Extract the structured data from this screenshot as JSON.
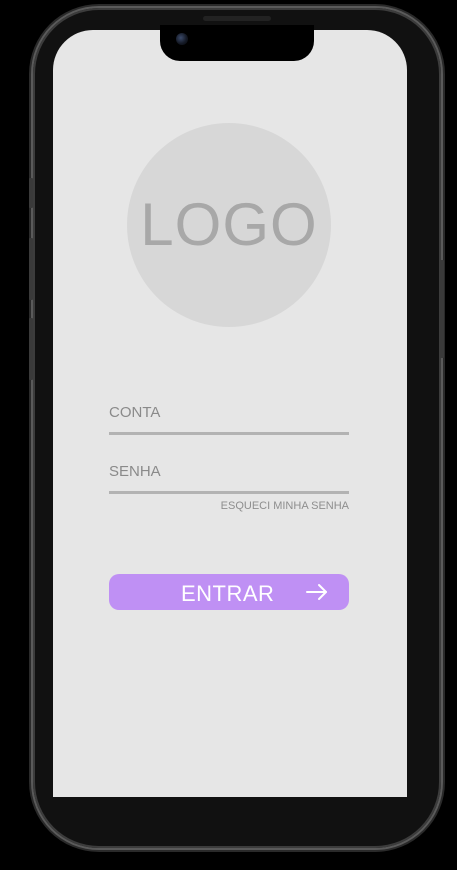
{
  "logo": {
    "text": "LOGO",
    "text_color": "#a8a8a8",
    "circle_color": "#d7d7d7"
  },
  "form": {
    "account_field": {
      "label": "CONTA",
      "value": ""
    },
    "password_field": {
      "label": "SENHA",
      "value": ""
    },
    "forgot_password_link": "ESQUECI MINHA SENHA",
    "submit": {
      "label": "ENTRAR",
      "icon": "arrow-right-icon",
      "color": "#bf90f4"
    }
  },
  "theme": {
    "screen_background": "#e6e6e6",
    "field_underline": "#b3b3b3"
  }
}
